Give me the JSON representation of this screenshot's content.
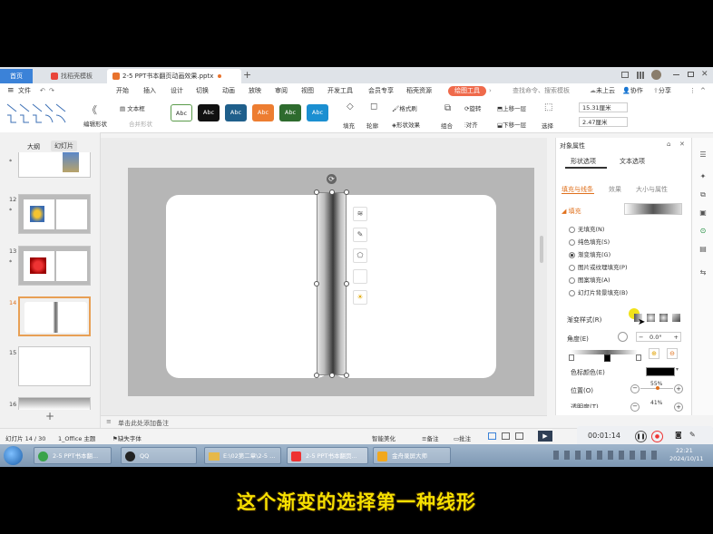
{
  "titlebar": {
    "tabs": [
      {
        "label": "首页"
      },
      {
        "label": "找稻壳模板"
      },
      {
        "label": "2-5 PPT书本翻页动画效果.pptx"
      }
    ],
    "new_tab": "+"
  },
  "menubar": {
    "file": "文件",
    "items": [
      "开始",
      "插入",
      "设计",
      "切换",
      "动画",
      "放映",
      "审阅",
      "视图",
      "开发工具",
      "会员专享",
      "稻壳资源"
    ],
    "drawing_tools": "绘图工具",
    "search": "查找命令、搜索模板",
    "cloud": "未上云",
    "collab": "协作",
    "share": "分享"
  },
  "ribbon": {
    "edit_shape": "编辑形状",
    "merge_shape": "合并形状",
    "textbox": "文本框",
    "styles": [
      "Abc",
      "Abc",
      "Abc",
      "Abc",
      "Abc",
      "Abc"
    ],
    "style_colors": [
      "#ffffff",
      "#111111",
      "#1f5f8b",
      "#ed7d31",
      "#2e6b2e",
      "#1b8fd1"
    ],
    "fill": "填充",
    "outline": "轮廓",
    "format_painter": "格式刷",
    "shape_effect": "形状效果",
    "combine": "组合",
    "rotate": "旋转",
    "align": "对齐",
    "bring_forward": "上移一层",
    "send_backward": "下移一层",
    "select": "选择",
    "height": "15.31厘米",
    "width": "2.47厘米"
  },
  "left_panel": {
    "tab_outline": "大纲",
    "tab_slides": "幻灯片",
    "slide_numbers": [
      "12",
      "13",
      "14",
      "15",
      "16"
    ],
    "add": "+"
  },
  "canvas": {
    "notes_placeholder": "单击此处添加备注"
  },
  "right_panel": {
    "title": "对象属性",
    "tab_shape": "形状选项",
    "tab_text": "文本选项",
    "sub_fill_line": "填充与线条",
    "sub_effect": "效果",
    "sub_size": "大小与属性",
    "fill_label": "填充",
    "fill_options": [
      "无填充(N)",
      "纯色填充(S)",
      "渐变填充(G)",
      "图片或纹理填充(P)",
      "图案填充(A)",
      "幻灯片背景填充(B)"
    ],
    "fill_selected_index": 2,
    "gradient_style_label": "渐变样式(R)",
    "angle_label": "角度(E)",
    "angle_value": "0.0°",
    "color_label": "色标颜色(E)",
    "color_value": "#000000",
    "position_label": "位置(O)",
    "position_value": "55%",
    "transparency_label": "透明度(T)",
    "transparency_value": "41%"
  },
  "statusbar": {
    "slide_info": "幻灯片 14 / 30",
    "theme": "1_Office 主题",
    "missing_font": "缺失字体",
    "smart_beautify": "智能美化",
    "notes": "备注",
    "comments": "批注",
    "timer": "00:01:14"
  },
  "taskbar": {
    "items": [
      "2-5 PPT书本翻...",
      "QQ",
      "E:\\02第二章\\2-5 ...",
      "2-5 PPT书本翻页...",
      "金舟录屏大师"
    ],
    "time": "22:21",
    "date": "2024/10/11"
  },
  "caption": "这个渐变的选择第一种线形"
}
